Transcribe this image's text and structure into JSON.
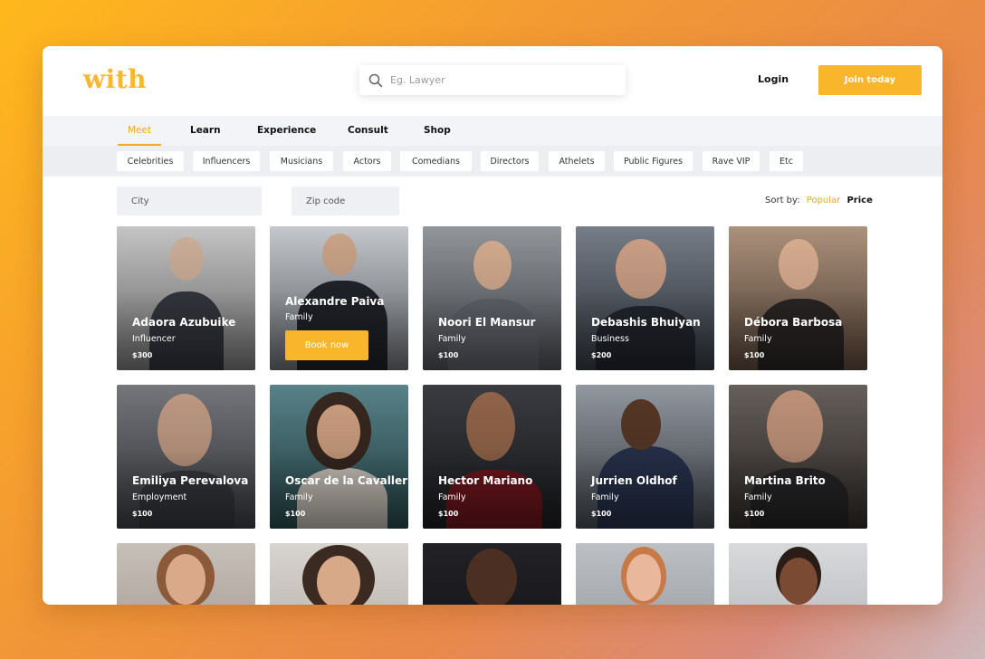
{
  "brand": {
    "logo_text": "with",
    "accent": "#f9b62a"
  },
  "search": {
    "placeholder": "Eg. Lawyer",
    "icon": "search-icon"
  },
  "header": {
    "login_label": "Login",
    "join_label": "Join today"
  },
  "nav": {
    "tabs": [
      "Meet",
      "Learn",
      "Experience",
      "Consult",
      "Shop"
    ],
    "active": "Meet"
  },
  "categories": [
    "Celebrities",
    "Influencers",
    "Musicians",
    "Actors",
    "Comedians",
    "Directors",
    "Athelets",
    "Public Figures",
    "Rave VIP",
    "Etc"
  ],
  "filters": {
    "city_placeholder": "City",
    "zip_placeholder": "Zip code"
  },
  "sort": {
    "label": "Sort by:",
    "options": [
      "Popular",
      "Price"
    ],
    "active": "Popular"
  },
  "profiles": [
    {
      "name": "Adaora Azubuike",
      "role": "Influencer",
      "price": "$300"
    },
    {
      "name": "Alexandre Paiva",
      "role": "Family",
      "book_label": "Book now"
    },
    {
      "name": "Noori El Mansur",
      "role": "Family",
      "price": "$100"
    },
    {
      "name": "Debashis Bhuiyan",
      "role": "Business",
      "price": "$200"
    },
    {
      "name": "Débora Barbosa",
      "role": "Family",
      "price": "$100"
    },
    {
      "name": "Emiliya Perevalova",
      "role": "Employment",
      "price": "$100"
    },
    {
      "name": "Oscar de la Cavallería",
      "role": "Family",
      "price": "$100"
    },
    {
      "name": "Hector Mariano",
      "role": "Family",
      "price": "$100"
    },
    {
      "name": "Jurrien Oldhof",
      "role": "Family",
      "price": "$100"
    },
    {
      "name": "Martina Brito",
      "role": "Family",
      "price": "$100"
    }
  ]
}
